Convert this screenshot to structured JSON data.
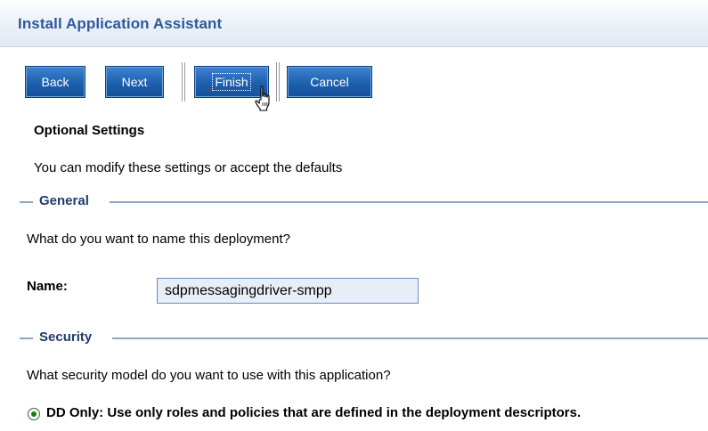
{
  "header": {
    "title": "Install Application Assistant"
  },
  "toolbar": {
    "back_label": "Back",
    "next_label": "Next",
    "finish_label": "Finish",
    "cancel_label": "Cancel"
  },
  "intro": {
    "heading": "Optional Settings",
    "description": "You can modify these settings or accept the defaults"
  },
  "general": {
    "section_label": "General",
    "question": "What do you want to name this deployment?",
    "name_label": "Name:",
    "name_value": "sdpmessagingdriver-smpp"
  },
  "security": {
    "section_label": "Security",
    "question": "What security model do you want to use with this application?",
    "options": [
      {
        "label": "DD Only: Use only roles and policies that are defined in the deployment descriptors.",
        "selected": true
      }
    ]
  },
  "colors": {
    "title": "#2d5a9b",
    "button": "#1e5fae",
    "section_label": "#1f3b68",
    "rule": "#8aa6c9",
    "input_background": "#e8eef8"
  }
}
